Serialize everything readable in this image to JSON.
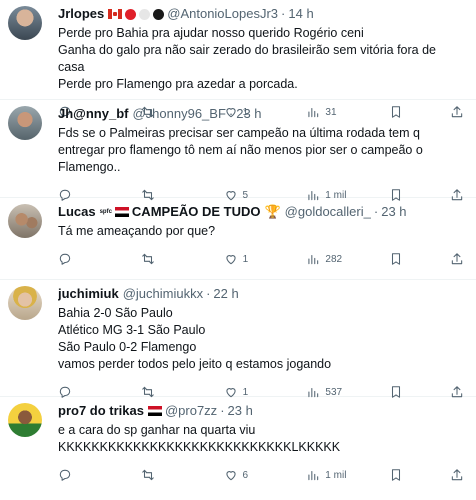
{
  "tweets": [
    {
      "name": "Jrlopes",
      "handle": "@AntonioLopesJr3",
      "time": "14 h",
      "text": "Perde pro Bahia pra ajudar nosso querido Rogério ceni\nGanha do galo pra não sair zerado do brasileirão sem vitória fora de casa\nPerde pro Flamengo pra azedar a porcada.",
      "replies": "",
      "retweets": "",
      "likes": "1",
      "views": "31"
    },
    {
      "name": "Jh@nny_bf",
      "handle": "@Jhonny96_BF",
      "time": "23 h",
      "text": "Fds se o Palmeiras precisar ser campeão na última rodada tem q entregar pro flamengo tô nem aí não menos pior ser o campeão o Flamengo..",
      "replies": "",
      "retweets": "",
      "likes": "5",
      "views": "1 mil"
    },
    {
      "name": "Lucas",
      "tag": "spfc",
      "name_suffix": "CAMPEÃO DE TUDO",
      "handle": "@goldocalleri_",
      "time": "23 h",
      "text": "Tá me ameaçando por que?",
      "replies": "",
      "retweets": "",
      "likes": "1",
      "views": "282"
    },
    {
      "name": "juchimiuk",
      "handle": "@juchimiukkx",
      "time": "22 h",
      "text": "Bahia 2-0 São Paulo\nAtlético MG 3-1 São Paulo\nSão Paulo 0-2 Flamengo\nvamos perder todos pelo jeito q estamos jogando",
      "replies": "",
      "retweets": "",
      "likes": "1",
      "views": "537"
    },
    {
      "name": "pro7 do trikas",
      "handle": "@pro7zz",
      "time": "23 h",
      "text": "e a cara do sp ganhar na quarta viu\nKKKKKKKKKKKKKKKKKKKKKKKKKKKKLKKKKK",
      "replies": "",
      "retweets": "",
      "likes": "6",
      "views": "1 mil"
    }
  ],
  "icons": {
    "reply": "reply-icon",
    "retweet": "retweet-icon",
    "like": "heart-icon",
    "views": "views-icon",
    "bookmark": "bookmark-icon",
    "share": "share-icon",
    "more": "more-icon"
  },
  "colors": {
    "text": "#0f1419",
    "secondary": "#536471",
    "border": "#eff3f4"
  }
}
